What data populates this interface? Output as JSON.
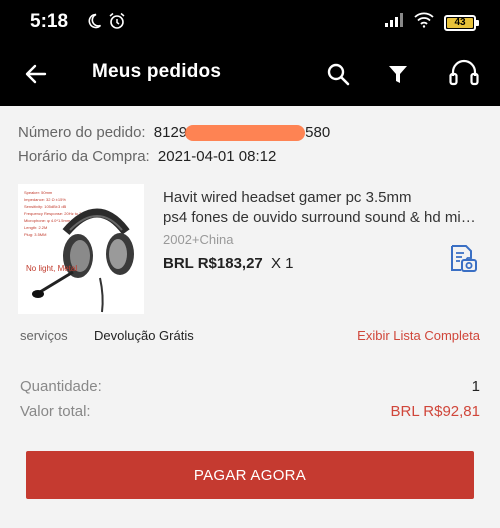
{
  "status_bar": {
    "time": "5:18",
    "battery_level": "43"
  },
  "app_bar": {
    "title": "Meus pedidos"
  },
  "order": {
    "number_label": "Número do pedido:",
    "number_visible_prefix": "8129",
    "number_visible_suffix": "580",
    "purchase_time_label": "Horário da Compra:",
    "purchase_time_value": "2021-04-01 08:12"
  },
  "product": {
    "title_line1": "Havit wired headset gamer pc 3.5mm",
    "title_line2": "ps4 fones de ouvido surround sound & hd mi…",
    "variant": "2002+China",
    "price": "BRL R$183,27",
    "quantity_suffix": "X 1",
    "image_caption": "No light, Metal",
    "image_specs": [
      "Speaker: 50mm",
      "Impedance: 32 Ω ±15%",
      "Sensitivity: 105dB±3 dB",
      "Frequency Response: 20Hz to 20KHZ",
      "Microphone: φ 4.0*1.5mm",
      "Length: 2.2M",
      "Plug: 3.5MM"
    ]
  },
  "services": {
    "label": "serviços",
    "value": "Devolução Grátis",
    "link": "Exibir Lista Completa"
  },
  "summary": {
    "quantity_label": "Quantidade:",
    "quantity_value": "1",
    "total_label": "Valor total:",
    "total_value": "BRL R$92,81"
  },
  "actions": {
    "pay_button": "PAGAR AGORA"
  },
  "colors": {
    "accent_red": "#c53a30",
    "link_red": "#d0463a",
    "header_bg": "#000000",
    "redaction": "#ff7a45"
  },
  "icons": {
    "back": "arrow-left-icon",
    "search": "search-icon",
    "filter": "filter-icon",
    "support": "headset-support-icon",
    "invoice": "invoice-camera-icon"
  }
}
